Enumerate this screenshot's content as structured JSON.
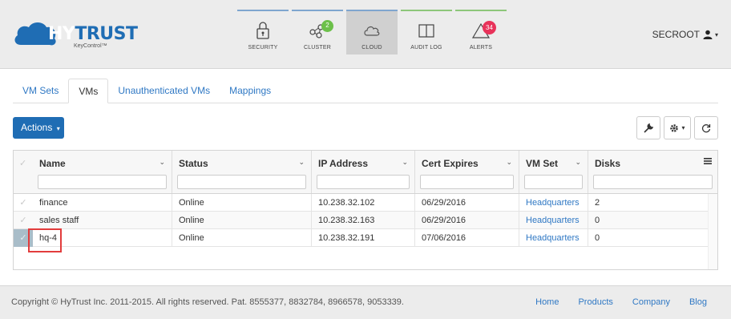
{
  "brand": {
    "name_part1": "HY",
    "name_part2": "TRUST",
    "subtitle": "KeyControl™",
    "accent": "#1f6db4"
  },
  "nav": [
    {
      "label": "SECURITY",
      "icon": "lock-icon",
      "bar": "#7fa6cf"
    },
    {
      "label": "CLUSTER",
      "icon": "cluster-icon",
      "badge": "2",
      "badge_color": "#6cc04a",
      "bar": "#7fa6cf"
    },
    {
      "label": "CLOUD",
      "icon": "cloud-icon",
      "bar": "#7fa6cf",
      "active": true
    },
    {
      "label": "AUDIT LOG",
      "icon": "book-icon",
      "bar": "#8dc77a"
    },
    {
      "label": "ALERTS",
      "icon": "warning-icon",
      "badge": "34",
      "badge_color": "#e8335a",
      "bar": "#8dc77a"
    }
  ],
  "user": {
    "name": "SECROOT"
  },
  "tabs": [
    {
      "label": "VM Sets",
      "active": false
    },
    {
      "label": "VMs",
      "active": true
    },
    {
      "label": "Unauthenticated VMs",
      "active": false
    },
    {
      "label": "Mappings",
      "active": false
    }
  ],
  "toolbar": {
    "actions_label": "Actions"
  },
  "table": {
    "columns": [
      "Name",
      "Status",
      "IP Address",
      "Cert Expires",
      "VM Set",
      "Disks"
    ],
    "rows": [
      {
        "name": "finance",
        "status": "Online",
        "ip": "10.238.32.102",
        "cert": "06/29/2016",
        "vmset": "Headquarters",
        "disks": "2",
        "selected": false
      },
      {
        "name": "sales staff",
        "status": "Online",
        "ip": "10.238.32.163",
        "cert": "06/29/2016",
        "vmset": "Headquarters",
        "disks": "0",
        "selected": false
      },
      {
        "name": "hq-4",
        "status": "Online",
        "ip": "10.238.32.191",
        "cert": "07/06/2016",
        "vmset": "Headquarters",
        "disks": "0",
        "selected": true
      }
    ]
  },
  "footer": {
    "copyright": "Copyright © HyTrust Inc. 2011-2015. All rights reserved. Pat. 8555377, 8832784, 8966578, 9053339.",
    "links": [
      "Home",
      "Products",
      "Company",
      "Blog"
    ]
  }
}
